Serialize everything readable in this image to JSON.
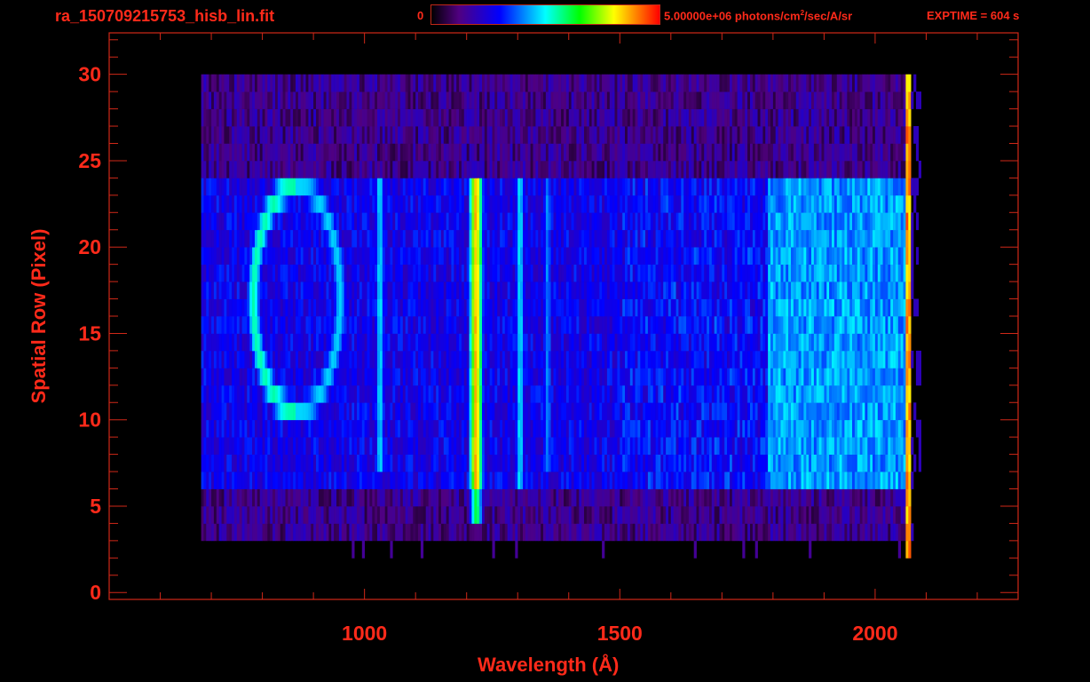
{
  "header": {
    "filename": "ra_150709215753_hisb_lin.fit",
    "colorbar_min": "0",
    "colorbar_max_prefix": "5.00000e+06 photons/cm",
    "colorbar_max_sup": "2",
    "colorbar_max_suffix": "/sec/A/sr",
    "exptime": "EXPTIME = 604 s"
  },
  "chart_data": {
    "type": "heatmap",
    "title": "ra_150709215753_hisb_lin.fit",
    "xlabel": "Wavelength (Å)",
    "ylabel": "Spatial Row (Pixel)",
    "xlim": [
      500,
      2280
    ],
    "ylim": [
      -0.4,
      32.4
    ],
    "xticks": [
      {
        "value": 1000,
        "label": "1000"
      },
      {
        "value": 1500,
        "label": "1500"
      },
      {
        "value": 2000,
        "label": "2000"
      }
    ],
    "xminor_step": 100,
    "yticks": [
      {
        "value": 0,
        "label": "0"
      },
      {
        "value": 5,
        "label": "5"
      },
      {
        "value": 10,
        "label": "10"
      },
      {
        "value": 15,
        "label": "15"
      },
      {
        "value": 20,
        "label": "20"
      },
      {
        "value": 25,
        "label": "25"
      },
      {
        "value": 30,
        "label": "30"
      }
    ],
    "yminor_step": 1,
    "colorbar": {
      "min": 0,
      "max": 5000000,
      "units": "photons/cm^2/sec/A/sr",
      "colormap": "rainbow"
    },
    "grid": false,
    "data_range": {
      "wavelength": [
        680,
        2090
      ],
      "rows": [
        3,
        30
      ]
    },
    "slit_rows": [
      7,
      24
    ],
    "features": [
      {
        "name": "Lyman-alpha",
        "wavelength": 1216,
        "rows": [
          5,
          24
        ],
        "level": 0.82
      },
      {
        "name": "ring",
        "wavelength": 865,
        "width": 85,
        "rows": [
          11,
          24
        ],
        "level": 0.55
      },
      {
        "name": "line-1026",
        "wavelength": 1028,
        "rows": [
          8,
          24
        ],
        "level": 0.45
      },
      {
        "name": "line-1304",
        "wavelength": 1302,
        "rows": [
          7,
          24
        ],
        "level": 0.45
      },
      {
        "name": "line-1356",
        "wavelength": 1356,
        "rows": [
          8,
          24
        ],
        "level": 0.38
      },
      {
        "name": "continuum-red",
        "wavelength_range": [
          1790,
          2060
        ],
        "rows": [
          7,
          24
        ],
        "level": 0.42
      },
      {
        "name": "detector-edge",
        "wavelength": 2062,
        "rows": [
          2,
          30
        ],
        "level": 0.95
      }
    ]
  }
}
